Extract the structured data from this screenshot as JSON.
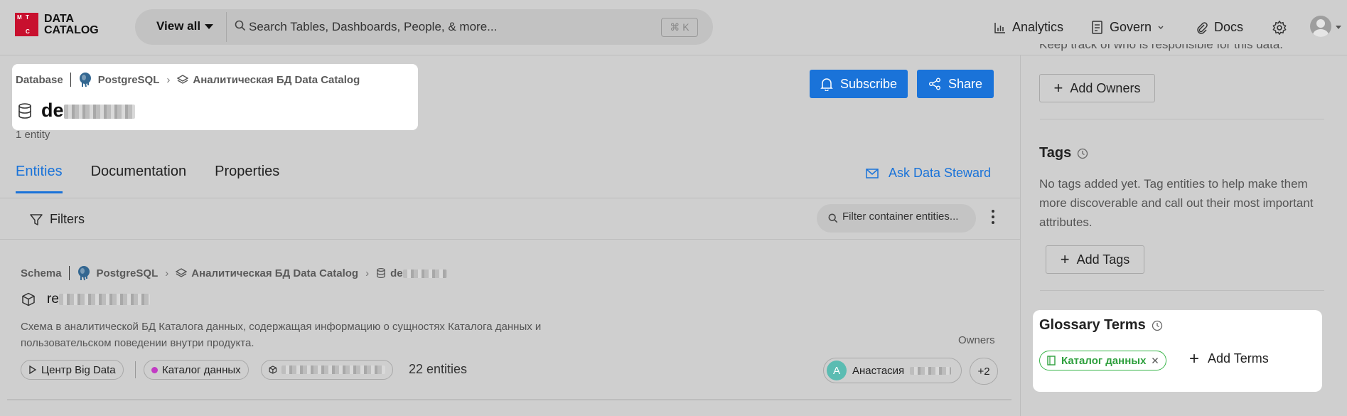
{
  "header": {
    "logo_letters": [
      "M",
      "T",
      "C"
    ],
    "logo_line1": "DATA",
    "logo_line2": "CATALOG",
    "view_all": "View all",
    "search_placeholder": "Search Tables, Dashboards, People, & more...",
    "search_shortcut": "⌘ K",
    "nav": {
      "analytics": "Analytics",
      "govern": "Govern",
      "docs": "Docs"
    }
  },
  "entity": {
    "type": "Database",
    "platform": "PostgreSQL",
    "container": "Аналитическая БД Data Catalog",
    "name_prefix": "de",
    "count": "1 entity"
  },
  "actions": {
    "subscribe": "Subscribe",
    "share": "Share"
  },
  "tabs": [
    "Entities",
    "Documentation",
    "Properties"
  ],
  "ask_steward": "Ask Data Steward",
  "filters": {
    "label": "Filters",
    "placeholder": "Filter container entities..."
  },
  "schema_row": {
    "type": "Schema",
    "platform": "PostgreSQL",
    "container": "Аналитическая БД Data Catalog",
    "database_prefix": "de",
    "name_prefix": "re",
    "description": "Схема в аналитической БД Каталога данных, содержащая информацию о сущностях Каталога данных и пользовательском поведении внутри продукта.",
    "owners_label": "Owners",
    "tags": [
      "Центр Big Data",
      "Каталог данных"
    ],
    "entities_count": "22 entities",
    "owner_initial": "A",
    "owner_name": "Анастасия",
    "more_owners": "+2"
  },
  "sidebar": {
    "owners_desc_cut": "Keep track of who is responsible for this data.",
    "add_owners": "Add Owners",
    "tags_title": "Tags",
    "tags_empty": "No tags added yet. Tag entities to help make them more discoverable and call out their most important attributes.",
    "add_tags": "Add Tags",
    "glossary_title": "Glossary Terms",
    "glossary_term": "Каталог данных",
    "add_terms": "Add Terms"
  },
  "colors": {
    "primary": "#1a73d9",
    "brand_red": "#c8102e",
    "glossary_green": "#2ea03d",
    "tag_dot_magenta": "#c23bc4",
    "owner_avatar": "#5bbcb2"
  }
}
